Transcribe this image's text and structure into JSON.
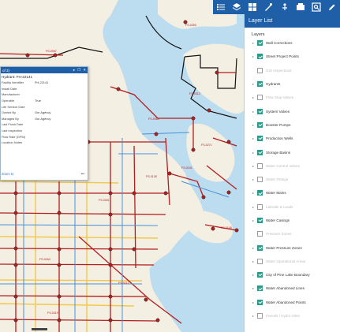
{
  "toolbar": {
    "icons": [
      "legend-icon",
      "layers-icon",
      "basemap-gallery-icon",
      "measure-icon",
      "draw-icon",
      "print-icon",
      "query-icon",
      "edit-icon"
    ]
  },
  "layer_list": {
    "title": "Layer List",
    "subtitle": "Layers",
    "items": [
      {
        "label": "Wall Corrections",
        "checked": true,
        "expandable": true
      },
      {
        "label": "Street Project Points",
        "checked": true,
        "expandable": true
      },
      {
        "label": "GIS Inspections",
        "checked": false,
        "expandable": false
      },
      {
        "label": "Hydrants",
        "checked": true,
        "expandable": true
      },
      {
        "label": "Flow Stop Valves",
        "checked": false,
        "expandable": true
      },
      {
        "label": "System Valves",
        "checked": true,
        "expandable": true
      },
      {
        "label": "Booster Pumps",
        "checked": true,
        "expandable": true
      },
      {
        "label": "Production Wells",
        "checked": true,
        "expandable": true
      },
      {
        "label": "Storage Basins",
        "checked": true,
        "expandable": true
      },
      {
        "label": "Water Control Valves",
        "checked": false,
        "expandable": true
      },
      {
        "label": "Water Fittings",
        "checked": false,
        "expandable": true
      },
      {
        "label": "Water Mains",
        "checked": true,
        "expandable": true
      },
      {
        "label": "Laterals & Leads",
        "checked": false,
        "expandable": true
      },
      {
        "label": "Water Casings",
        "checked": true,
        "expandable": true
      },
      {
        "label": "Pressure Zones",
        "checked": false,
        "expandable": false
      },
      {
        "label": "Water Pressure Zones",
        "checked": true,
        "expandable": true
      },
      {
        "label": "Water Operational Areas",
        "checked": false,
        "expandable": true
      },
      {
        "label": "City of Pine Lake Boundary",
        "checked": true,
        "expandable": true
      },
      {
        "label": "Water Abandoned Lines",
        "checked": true,
        "expandable": true
      },
      {
        "label": "Water Abandoned Points",
        "checked": true,
        "expandable": true
      },
      {
        "label": "Parcels / Hydro Sites",
        "checked": false,
        "expandable": true
      }
    ]
  },
  "popup": {
    "title": "of 3)",
    "buttons": [
      "▸",
      "❐",
      "✕"
    ],
    "heading": "Hydrant: FH-22141",
    "fields": [
      {
        "key": "Facility Identifier",
        "value": "FH-22141"
      },
      {
        "key": "Install Date",
        "value": ""
      },
      {
        "key": "Manufacturer",
        "value": ""
      },
      {
        "key": "Operable",
        "value": "True"
      },
      {
        "key": "Life Service Date",
        "value": ""
      },
      {
        "key": "Owned By",
        "value": "Our Agency"
      },
      {
        "key": "Managed By",
        "value": "Our Agency"
      },
      {
        "key": "Last Flush Date",
        "value": ""
      },
      {
        "key": "Last Inspection",
        "value": ""
      },
      {
        "key": "Flow Rate (GPM)",
        "value": ""
      },
      {
        "key": "Location Notes",
        "value": ""
      }
    ],
    "zoom_link": "Zoom to",
    "more": "•••"
  },
  "map": {
    "colors": {
      "land": "#f4efe3",
      "water": "#bcdcef",
      "main": "#b21e1e",
      "lateral": "#4a90d9",
      "road": "#f2c84b",
      "boundary": "#111111"
    },
    "labels": [
      "FS-0067",
      "FS-0063",
      "FS-0271",
      "FS-0241",
      "FS-0128",
      "FS-0301",
      "FS-0312",
      "FS-0145",
      "FS-0184",
      "FS-0212",
      "FS-0319",
      "FS-0250"
    ]
  }
}
